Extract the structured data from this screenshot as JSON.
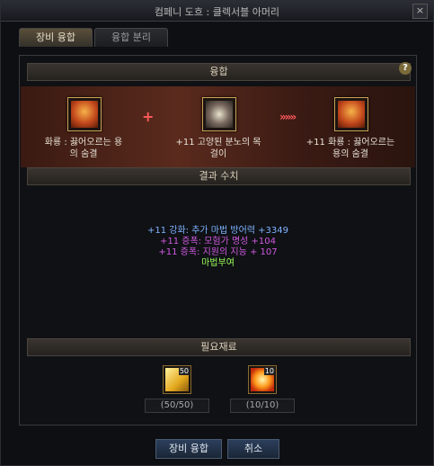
{
  "window": {
    "title": "컴페니 도흐 : 클렉서블 아머리"
  },
  "tabs": [
    {
      "label": "장비 융합"
    },
    {
      "label": "융합 분리"
    }
  ],
  "fusion": {
    "header": "융합",
    "item_left": "화룡 : 끓어오르는 용\n의 숨결",
    "item_middle": "+11  고양된 분노의 목\n걸이",
    "item_right": "+11  화룡 : 끓어오르는\n용의 숨결",
    "plus_symbol": "+",
    "arrow_symbol": "»»»"
  },
  "result": {
    "header": "결과 수치",
    "lines": [
      {
        "text": "+11  강화: 추가 마법 방어력 +3349"
      },
      {
        "text": "+11  증폭: 모험가 명성 +104"
      },
      {
        "text": "+11  증폭: 지원의 지능 + 107"
      },
      {
        "text": "마법부여"
      }
    ]
  },
  "materials": {
    "header": "필요재료",
    "items": [
      {
        "icon": "gold-card-icon",
        "badge": "50",
        "count": "(50/50)"
      },
      {
        "icon": "fire-orb-icon",
        "badge": "10",
        "count": "(10/10)"
      }
    ]
  },
  "buttons": {
    "confirm": "장비 융합",
    "cancel": "취소"
  },
  "colors": {
    "stat_blue": "#7fb2ff",
    "stat_magenta": "#d05ae0",
    "stat_green": "#9cff5a",
    "plus": "#ff5a5a"
  }
}
